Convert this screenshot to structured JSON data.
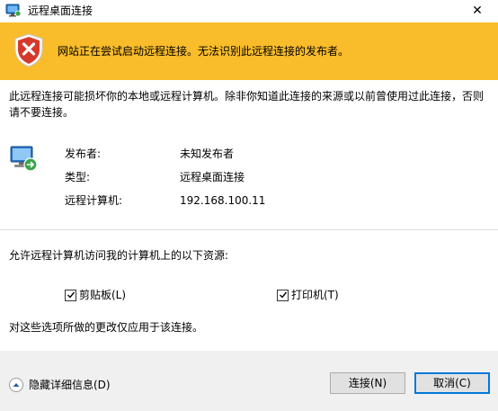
{
  "window": {
    "title": "远程桌面连接",
    "close_glyph": "✕"
  },
  "banner": {
    "message": "网站正在尝试启动远程连接。无法识别此远程连接的发布者。",
    "icon": "warning-shield-icon",
    "color": "#f9bc2a"
  },
  "description": "此远程连接可能损坏你的本地或远程计算机。除非你知道此连接的来源或以前曾使用过此连接，否则请不要连接。",
  "details": {
    "icon": "remote-computer-icon",
    "rows": [
      {
        "label": "发布者:",
        "value": "未知发布者"
      },
      {
        "label": "类型:",
        "value": "远程桌面连接"
      },
      {
        "label": "远程计算机:",
        "value": "192.168.100.11"
      }
    ]
  },
  "resources": {
    "heading": "允许远程计算机访问我的计算机上的以下资源:",
    "items": [
      {
        "label": "剪贴板(L)",
        "checked": true
      },
      {
        "label": "打印机(T)",
        "checked": true
      }
    ],
    "note": "对这些选项所做的更改仅应用于该连接。"
  },
  "footer": {
    "toggle_label": "隐藏详细信息(D)",
    "connect_label": "连接(N)",
    "cancel_label": "取消(C)"
  }
}
